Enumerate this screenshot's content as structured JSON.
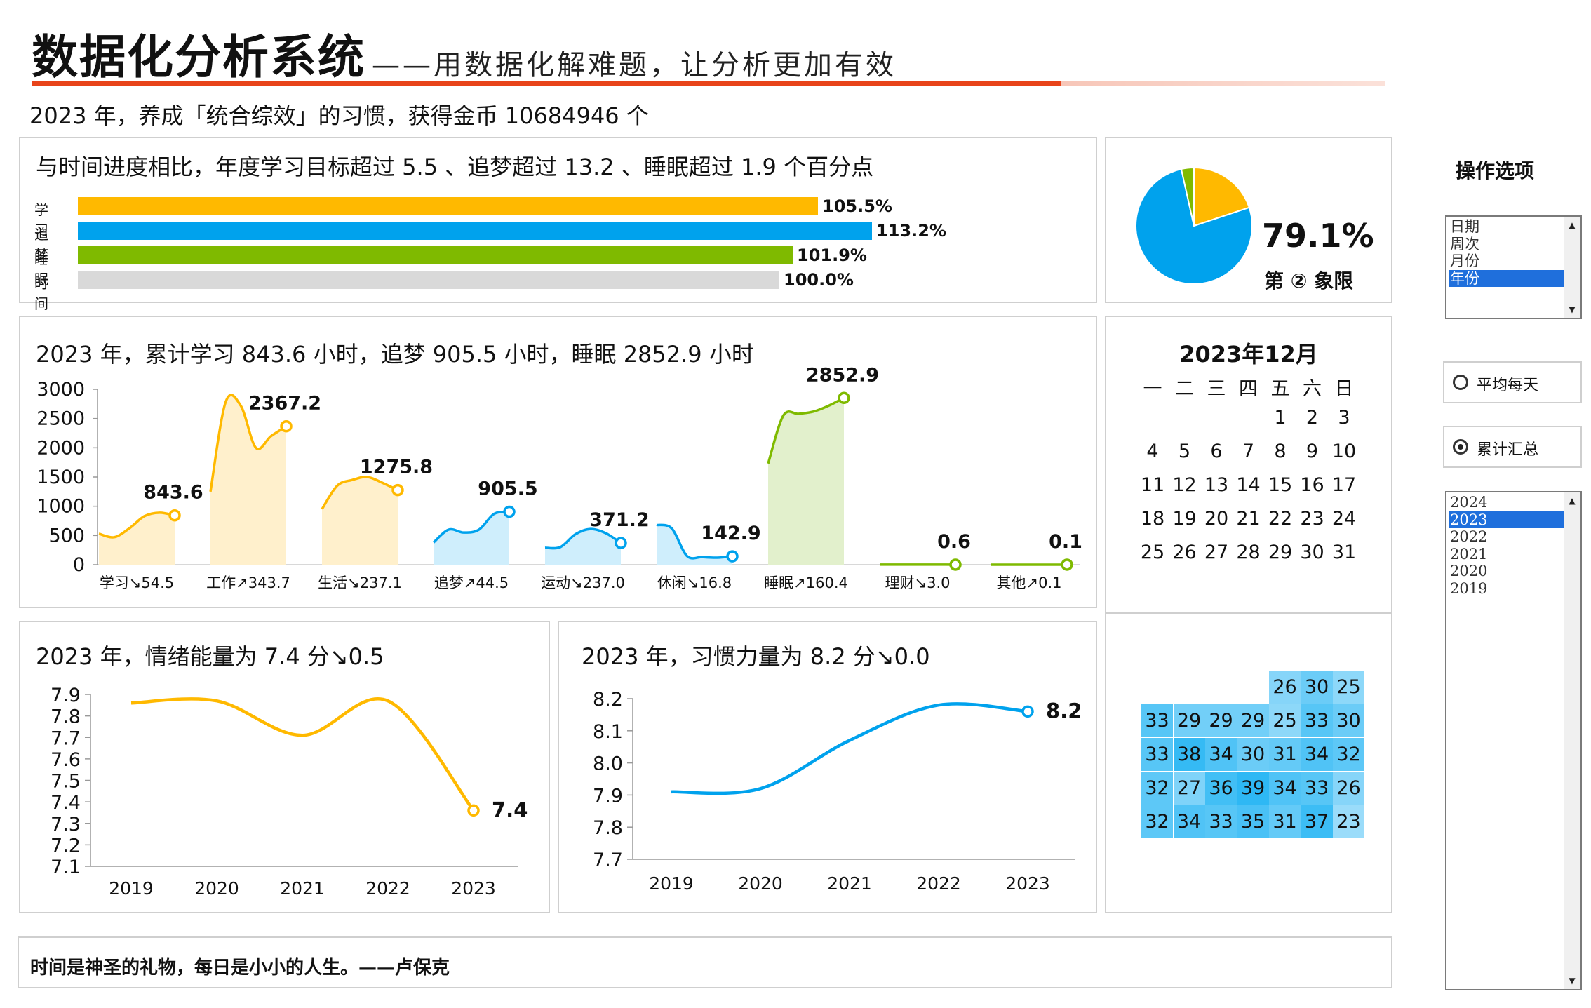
{
  "header": {
    "title": "数据化分析系统",
    "subtitle": "——用数据化解难题，让分析更加有效",
    "summary": "2023 年，养成「统合综效」的习惯，获得金币 10684946 个"
  },
  "progress_panel": {
    "title": "与时间进度相比，年度学习目标超过 5.5 、追梦超过 13.2 、睡眠超过 1.9 个百分点",
    "bars": [
      {
        "label": "学习",
        "value_text": "105.5%",
        "value": 105.5,
        "color": "#ffb900"
      },
      {
        "label": "追梦",
        "value_text": "113.2%",
        "value": 113.2,
        "color": "#00a2ed"
      },
      {
        "label": "睡眠",
        "value_text": "101.9%",
        "value": 101.9,
        "color": "#7fba00"
      },
      {
        "label": "时间",
        "value_text": "100.0%",
        "value": 100.0,
        "color": "#d9d9d9"
      }
    ]
  },
  "pie_panel": {
    "percent": "79.1%",
    "quadrant": "第 ② 象限",
    "chart_data": {
      "type": "pie",
      "slices": [
        {
          "value": 19.9,
          "color": "#ffb900"
        },
        {
          "value": 76.6,
          "color": "#00a2ed"
        },
        {
          "value": 3.5,
          "color": "#7fba00"
        }
      ]
    }
  },
  "hours_panel": {
    "title": "2023 年，累计学习 843.6 小时，追梦 905.5 小时，睡眠 2852.9 小时",
    "chart_data": {
      "type": "area",
      "yticks": [
        "3000",
        "2500",
        "2000",
        "1500",
        "1000",
        "500",
        "0"
      ],
      "ylim": [
        0,
        3000
      ],
      "categories": [
        {
          "label": "学习↘54.5",
          "end_label": "843.6",
          "values": [
            530,
            470,
            620,
            830,
            890,
            843.6
          ],
          "color": "#ffb900",
          "fill": "#fff0cc"
        },
        {
          "label": "工作↗343.7",
          "end_label": "2367.2",
          "values": [
            1250,
            2780,
            2720,
            2000,
            2200,
            2367.2
          ],
          "color": "#ffb900",
          "fill": "#fff0cc"
        },
        {
          "label": "生活↘237.1",
          "end_label": "1275.8",
          "values": [
            950,
            1350,
            1450,
            1500,
            1400,
            1275.8
          ],
          "color": "#ffb900",
          "fill": "#fff0cc"
        },
        {
          "label": "追梦↗44.5",
          "end_label": "905.5",
          "values": [
            380,
            600,
            550,
            600,
            870,
            905.5
          ],
          "color": "#00a2ed",
          "fill": "#cfeefc"
        },
        {
          "label": "运动↘237.0",
          "end_label": "371.2",
          "values": [
            290,
            300,
            520,
            610,
            540,
            371.2
          ],
          "color": "#00a2ed",
          "fill": "#cfeefc"
        },
        {
          "label": "休闲↘16.8",
          "end_label": "142.9",
          "values": [
            680,
            620,
            150,
            130,
            120,
            142.9
          ],
          "color": "#00a2ed",
          "fill": "#cfeefc"
        },
        {
          "label": "睡眠↗160.4",
          "end_label": "2852.9",
          "values": [
            1730,
            2550,
            2580,
            2620,
            2720,
            2852.9
          ],
          "color": "#7fba00",
          "fill": "#e2f0cc"
        },
        {
          "label": "理财↘3.0",
          "end_label": "0.6",
          "values": [
            2,
            1,
            1,
            1,
            1,
            0.6
          ],
          "color": "#7fba00",
          "fill": "#e2f0cc"
        },
        {
          "label": "其他↗0.1",
          "end_label": "0.1",
          "values": [
            0,
            0,
            0,
            0,
            0,
            0.1
          ],
          "color": "#7fba00",
          "fill": "#e2f0cc"
        }
      ]
    }
  },
  "emotion_panel": {
    "title": "2023 年，情绪能量为 7.4 分↘0.5",
    "end_label": "7.4",
    "chart_data": {
      "type": "line",
      "x": [
        "2019",
        "2020",
        "2021",
        "2022",
        "2023"
      ],
      "values": [
        7.86,
        7.87,
        7.71,
        7.87,
        7.36
      ],
      "yticks": [
        "7.9",
        "7.8",
        "7.7",
        "7.6",
        "7.5",
        "7.4",
        "7.3",
        "7.2",
        "7.1"
      ],
      "ylim": [
        7.1,
        7.9
      ],
      "color": "#ffb900"
    }
  },
  "habit_panel": {
    "title": "2023 年，习惯力量为 8.2 分↘0.0",
    "end_label": "8.2",
    "chart_data": {
      "type": "line",
      "x": [
        "2019",
        "2020",
        "2021",
        "2022",
        "2023"
      ],
      "values": [
        7.91,
        7.92,
        8.07,
        8.18,
        8.16
      ],
      "yticks": [
        "8.2",
        "8.1",
        "8.0",
        "7.9",
        "7.8",
        "7.7"
      ],
      "ylim": [
        7.7,
        8.2
      ],
      "color": "#00a2ed"
    }
  },
  "calendar": {
    "title": "2023年12月",
    "weekdays": [
      "一",
      "二",
      "三",
      "四",
      "五",
      "六",
      "日"
    ],
    "weeks": [
      [
        "",
        "",
        "",
        "",
        "1",
        "2",
        "3"
      ],
      [
        "4",
        "5",
        "6",
        "7",
        "8",
        "9",
        "10"
      ],
      [
        "11",
        "12",
        "13",
        "14",
        "15",
        "16",
        "17"
      ],
      [
        "18",
        "19",
        "20",
        "21",
        "22",
        "23",
        "24"
      ],
      [
        "25",
        "26",
        "27",
        "28",
        "29",
        "30",
        "31"
      ]
    ]
  },
  "heatmap": {
    "rows": [
      [
        "",
        "",
        "",
        "",
        "26",
        "30",
        "25"
      ],
      [
        "33",
        "29",
        "29",
        "29",
        "25",
        "33",
        "30"
      ],
      [
        "33",
        "38",
        "34",
        "30",
        "31",
        "34",
        "32"
      ],
      [
        "32",
        "27",
        "36",
        "39",
        "34",
        "33",
        "26"
      ],
      [
        "32",
        "34",
        "33",
        "35",
        "31",
        "37",
        "23"
      ]
    ]
  },
  "quote": "时间是神圣的礼物，每日是小小的人生。——卢保克",
  "controls": {
    "title": "操作选项",
    "period_list": {
      "items": [
        "日期",
        "周次",
        "月份",
        "年份"
      ],
      "selected": "年份"
    },
    "radios": [
      {
        "label": "平均每天",
        "checked": false
      },
      {
        "label": "累计汇总",
        "checked": true
      }
    ],
    "year_list": {
      "items": [
        "2024",
        "2023",
        "2022",
        "2021",
        "2020",
        "2019"
      ],
      "selected": "2023"
    }
  }
}
